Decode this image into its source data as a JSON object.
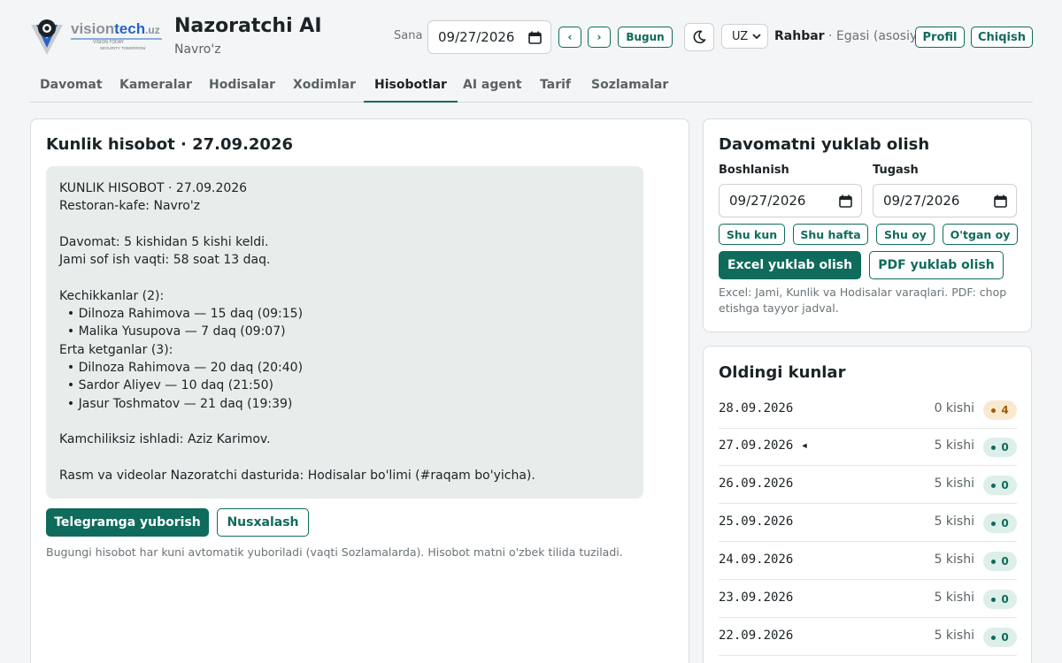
{
  "brand": {
    "logo_text": "visiontech",
    "logo_tld": ".uz",
    "logo_tagline_1": "VISION TODAY",
    "logo_tagline_2": "SECURITY TOMORROW",
    "app_title": "Nazoratchi AI",
    "org_name": "Navro'z"
  },
  "header": {
    "date_label": "Sana",
    "date_value": "09/27/2026",
    "prev_label": "‹",
    "next_label": "›",
    "today_label": "Bugun",
    "theme_icon": "moon-icon",
    "lang_value": "UZ",
    "user_role": "Rahbar",
    "user_sep": " · ",
    "user_owner": "Egasi (asosiy)",
    "profile_label": "Profil",
    "logout_label": "Chiqish"
  },
  "tabs": [
    {
      "label": "Davomat",
      "active": false
    },
    {
      "label": "Kameralar",
      "active": false
    },
    {
      "label": "Hodisalar",
      "active": false
    },
    {
      "label": "Xodimlar",
      "active": false
    },
    {
      "label": "Hisobotlar",
      "active": true
    },
    {
      "label": "AI agent",
      "active": false
    },
    {
      "label": "Tarif",
      "active": false
    },
    {
      "label": "Sozlamalar",
      "active": false
    }
  ],
  "report": {
    "title": "Kunlik hisobot · 27.09.2026",
    "text": "KUNLIK HISOBOT · 27.09.2026\nRestoran-kafe: Navro'z\n\nDavomat: 5 kishidan 5 kishi keldi.\nJami sof ish vaqti: 58 soat 13 daq.\n\nKechikkanlar (2):\n  • Dilnoza Rahimova — 15 daq (09:15)\n  • Malika Yusupova — 7 daq (09:07)\nErta ketganlar (3):\n  • Dilnoza Rahimova — 20 daq (20:40)\n  • Sardor Aliyev — 10 daq (21:50)\n  • Jasur Toshmatov — 21 daq (19:39)\n\nKamchiliksiz ishladi: Aziz Karimov.\n\nRasm va videolar Nazoratchi dasturida: Hodisalar bo'limi (#raqam bo'yicha).",
    "send_label": "Telegramga yuborish",
    "copy_label": "Nusxalash",
    "hint": "Bugungi hisobot har kuni avtomatik yuboriladi (vaqti Sozlamalarda). Hisobot matni o'zbek tilida tuziladi."
  },
  "export": {
    "title": "Davomatni yuklab olish",
    "start_label": "Boshlanish",
    "end_label": "Tugash",
    "start_value": "09/27/2026",
    "end_value": "09/27/2026",
    "presets": [
      "Shu kun",
      "Shu hafta",
      "Shu oy",
      "O'tgan oy"
    ],
    "excel_label": "Excel yuklab olish",
    "pdf_label": "PDF yuklab olish",
    "hint": "Excel: Jami, Kunlik va Hodisalar varaqlari. PDF: chop etishga tayyor jadval."
  },
  "history": {
    "title": "Oldingi kunlar",
    "rows": [
      {
        "date": "28.09.2026",
        "marker": "",
        "count": "0 kishi",
        "badge": "4",
        "status": "warn"
      },
      {
        "date": "27.09.2026",
        "marker": "◂",
        "count": "5 kishi",
        "badge": "0",
        "status": "ok"
      },
      {
        "date": "26.09.2026",
        "marker": "",
        "count": "5 kishi",
        "badge": "0",
        "status": "ok"
      },
      {
        "date": "25.09.2026",
        "marker": "",
        "count": "5 kishi",
        "badge": "0",
        "status": "ok"
      },
      {
        "date": "24.09.2026",
        "marker": "",
        "count": "5 kishi",
        "badge": "0",
        "status": "ok"
      },
      {
        "date": "23.09.2026",
        "marker": "",
        "count": "5 kishi",
        "badge": "0",
        "status": "ok"
      },
      {
        "date": "22.09.2026",
        "marker": "",
        "count": "5 kishi",
        "badge": "0",
        "status": "ok"
      }
    ]
  },
  "colors": {
    "accent": "#0f6b5c",
    "warn_bg": "#fbe9cf",
    "ok_bg": "#dcefe8"
  }
}
